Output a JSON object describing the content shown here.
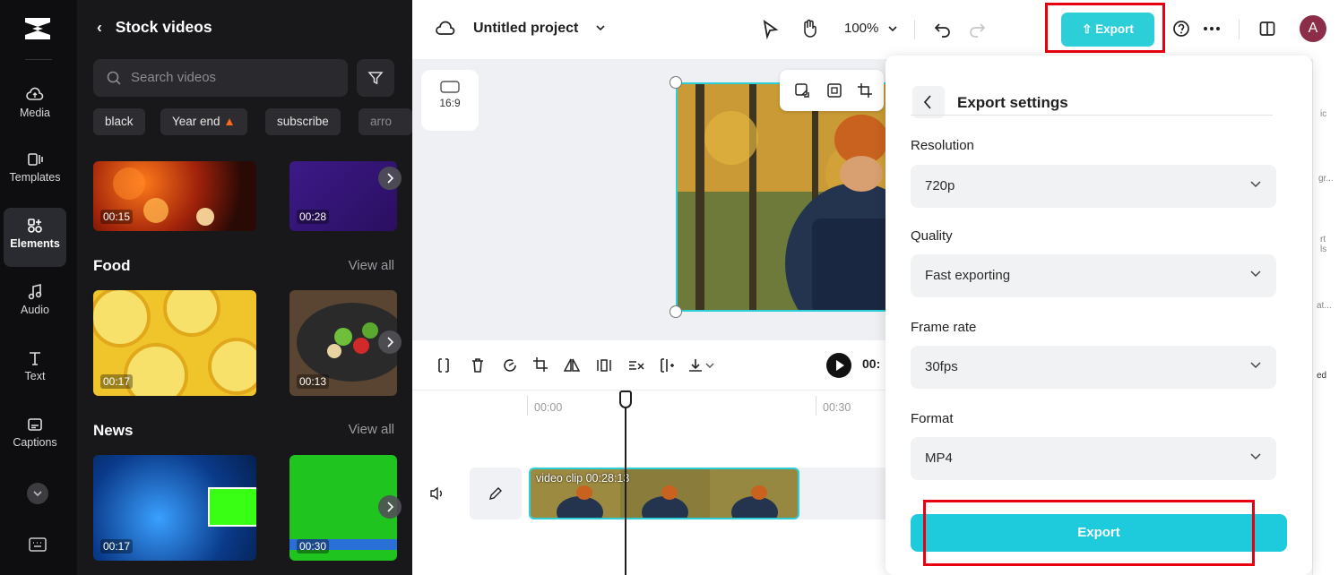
{
  "rail": {
    "items": [
      {
        "label": "Media",
        "icon": "cloud-icon"
      },
      {
        "label": "Templates",
        "icon": "templates-icon"
      },
      {
        "label": "Elements",
        "icon": "elements-icon"
      },
      {
        "label": "Audio",
        "icon": "music-note-icon"
      },
      {
        "label": "Text",
        "icon": "text-icon"
      },
      {
        "label": "Captions",
        "icon": "captions-icon"
      }
    ]
  },
  "panel": {
    "title": "Stock videos",
    "search_placeholder": "Search videos",
    "chips": [
      "black",
      "Year end",
      "subscribe",
      "arro"
    ],
    "top_row": {
      "durations": [
        "00:15",
        "00:28"
      ]
    },
    "sections": [
      {
        "title": "Food",
        "view_all": "View all",
        "durations": [
          "00:17",
          "00:13"
        ]
      },
      {
        "title": "News",
        "view_all": "View all",
        "durations": [
          "00:17",
          "00:30"
        ]
      }
    ]
  },
  "topbar": {
    "project_name": "Untitled project",
    "zoom": "100%",
    "export_label": "Export",
    "avatar_initial": "A"
  },
  "canvas": {
    "aspect_ratio": "16:9"
  },
  "timeline": {
    "time_display": "00:",
    "ticks": [
      "00:00",
      "00:30"
    ],
    "clip": {
      "label": "video clip",
      "duration": "00:28:13"
    }
  },
  "right_strip": {
    "labels": [
      "ic",
      "gr...",
      "rt\nls",
      "at...",
      "ed"
    ]
  },
  "export_settings": {
    "title": "Export settings",
    "fields": [
      {
        "label": "Resolution",
        "value": "720p"
      },
      {
        "label": "Quality",
        "value": "Fast exporting"
      },
      {
        "label": "Frame rate",
        "value": "30fps"
      },
      {
        "label": "Format",
        "value": "MP4"
      }
    ],
    "export_button": "Export"
  },
  "colors": {
    "accent": "#2ccfd8",
    "highlight_box": "#e60012",
    "panel_bg": "#18181b",
    "rail_bg": "#0e0e10"
  }
}
